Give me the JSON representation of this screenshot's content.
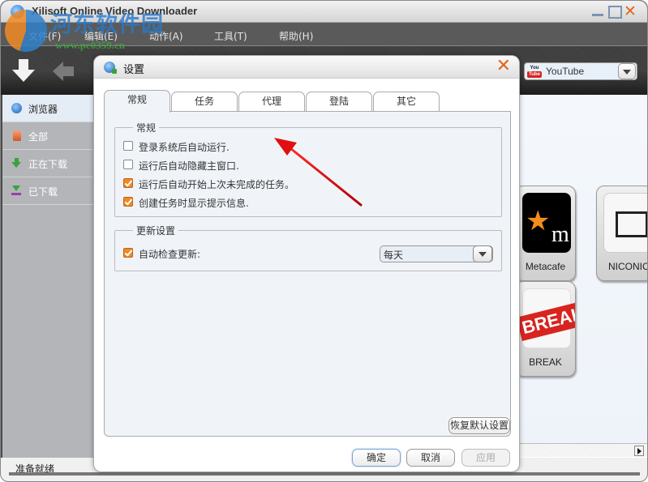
{
  "window": {
    "title": "Xilisoft Online Video Downloader",
    "controls": [
      "minimize",
      "maximize",
      "close"
    ]
  },
  "watermark": {
    "text": "河东软件园",
    "url": "www.pc0359.cn"
  },
  "menubar": {
    "items": [
      "文件(F)",
      "编辑(E)",
      "动作(A)",
      "工具(T)",
      "帮助(H)"
    ]
  },
  "toolbar": {
    "buttons": [
      {
        "icon": "download-arrow-icon",
        "enabled": true
      },
      {
        "icon": "back-arrow-icon",
        "enabled": false
      }
    ],
    "site_selector": {
      "icon": "youtube-icon",
      "icon_text_top": "You",
      "icon_text_bottom": "Tube",
      "value": "YouTube"
    }
  },
  "sidebar": {
    "items": [
      {
        "label": "浏览器",
        "icon": "globe-icon",
        "active": true
      },
      {
        "label": "全部",
        "icon": "document-icon",
        "active": false
      },
      {
        "label": "正在下载",
        "icon": "download-icon",
        "active": false
      },
      {
        "label": "已下载",
        "icon": "downloaded-icon",
        "active": false
      }
    ]
  },
  "sites": [
    {
      "label": "Metacafe"
    },
    {
      "label": "NICONICO"
    },
    {
      "label": "BREAK",
      "logo_text": "BREAK"
    }
  ],
  "status": {
    "text": "准备就绪"
  },
  "dialog": {
    "title": "设置",
    "tabs": [
      {
        "label": "常规",
        "active": true
      },
      {
        "label": "任务",
        "active": false
      },
      {
        "label": "代理",
        "active": false
      },
      {
        "label": "登陆",
        "active": false
      },
      {
        "label": "其它",
        "active": false
      }
    ],
    "general_group": {
      "legend": "常规",
      "options": [
        {
          "label": "登录系统后自动运行.",
          "checked": false
        },
        {
          "label": "运行后自动隐藏主窗口.",
          "checked": false
        },
        {
          "label": "运行后自动开始上次未完成的任务。",
          "checked": true
        },
        {
          "label": "创建任务时显示提示信息.",
          "checked": true
        }
      ]
    },
    "update_group": {
      "legend": "更新设置",
      "auto_check": {
        "label": "自动检查更新:",
        "checked": true
      },
      "frequency": "每天"
    },
    "restore_defaults_label": "恢复默认设置",
    "ok_label": "确定",
    "cancel_label": "取消",
    "apply_label": "应用",
    "apply_enabled": false
  },
  "annotation": {
    "type": "red-arrow",
    "points_to": "general-group"
  }
}
